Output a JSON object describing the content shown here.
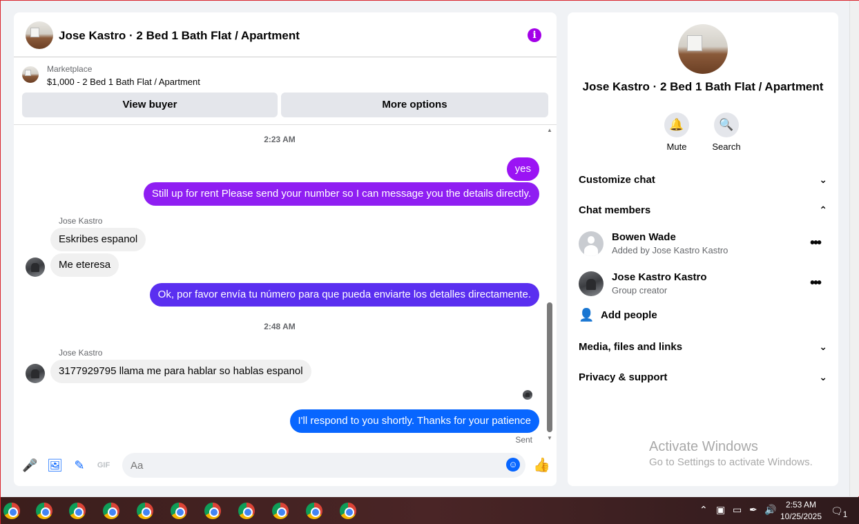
{
  "chat": {
    "title": "Jose Kastro · 2 Bed 1 Bath Flat / Apartment",
    "info_icon": "i",
    "marketplace_label": "Marketplace",
    "listing": "$1,000 - 2 Bed 1 Bath Flat / Apartment",
    "view_buyer": "View buyer",
    "more_options": "More options",
    "time1": "2:23 AM",
    "time2": "2:48 AM",
    "messages": [
      {
        "dir": "out",
        "text": "yes"
      },
      {
        "dir": "out",
        "text": "Still up for rent Please send your number so I can message you the details directly."
      },
      {
        "dir": "in",
        "sender": "Jose Kastro",
        "text": "Eskribes espanol"
      },
      {
        "dir": "in",
        "text": "Me eteresa"
      },
      {
        "dir": "out",
        "text": "Ok, por favor envía tu número para que pueda enviarte los detalles directamente."
      },
      {
        "dir": "in",
        "sender": "Jose Kastro",
        "text": "3177929795 llama me para hablar so hablas espanol"
      },
      {
        "dir": "out",
        "text": "I'll respond to you shortly. Thanks for your patience"
      }
    ],
    "status": "Sent",
    "input_placeholder": "Aa",
    "accent": "#a100ff"
  },
  "details": {
    "title": "Jose Kastro · 2 Bed 1 Bath Flat / Apartment",
    "mute": "Mute",
    "search": "Search",
    "customize": "Customize chat",
    "members_heading": "Chat members",
    "members": [
      {
        "name": "Bowen Wade",
        "sub": "Added by Jose Kastro Kastro"
      },
      {
        "name": "Jose Kastro Kastro",
        "sub": "Group creator"
      }
    ],
    "add_people": "Add people",
    "media": "Media, files and links",
    "privacy": "Privacy & support"
  },
  "watermark": {
    "line1": "Activate Windows",
    "line2": "Go to Settings to activate Windows."
  },
  "taskbar": {
    "time": "2:53 AM",
    "date": "10/25/2025",
    "notifications": "1"
  }
}
